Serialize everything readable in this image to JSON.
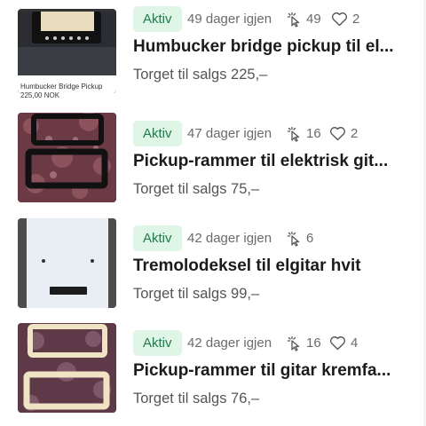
{
  "listings": [
    {
      "status": "Aktiv",
      "days_left": "49 dager igjen",
      "clicks": "49",
      "likes": "2",
      "title": "Humbucker bridge pickup til el...",
      "price": "Torget til salgs 225,–",
      "thumb_caption": "Humbucker Bridge Pickup",
      "thumb_caption_price": "225,00 NOK"
    },
    {
      "status": "Aktiv",
      "days_left": "47 dager igjen",
      "clicks": "16",
      "likes": "2",
      "title": "Pickup-rammer til elektrisk git...",
      "price": "Torget til salgs 75,–"
    },
    {
      "status": "Aktiv",
      "days_left": "42 dager igjen",
      "clicks": "6",
      "title": "Tremolodeksel til elgitar hvit",
      "price": "Torget til salgs 99,–"
    },
    {
      "status": "Aktiv",
      "days_left": "42 dager igjen",
      "clicks": "16",
      "likes": "4",
      "title": "Pickup-rammer til gitar kremfa...",
      "price": "Torget til salgs 76,–"
    }
  ],
  "colors": {
    "badge_bg": "#dff5e6",
    "badge_text": "#227a4c"
  },
  "icons": {
    "clicks": "cursor-click-icon",
    "likes": "heart-icon"
  }
}
